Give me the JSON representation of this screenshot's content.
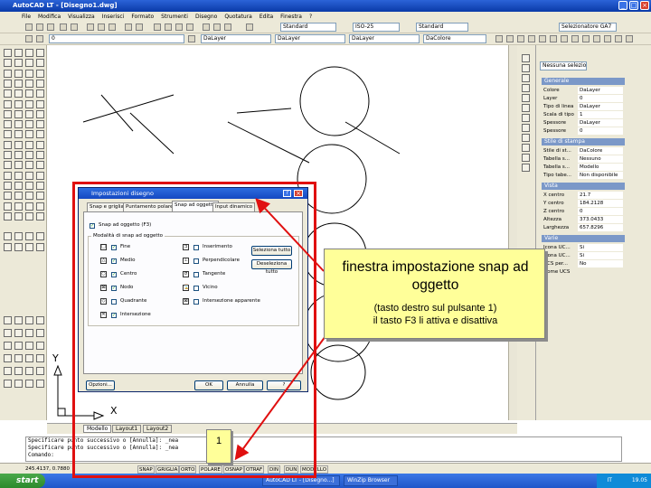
{
  "window": {
    "title": "AutoCAD LT - [Disegno1.dwg]"
  },
  "menu": [
    "File",
    "Modifica",
    "Visualizza",
    "Inserisci",
    "Formato",
    "Strumenti",
    "Disegno",
    "Quotatura",
    "Edita",
    "Finestra",
    "?"
  ],
  "toolbar": {
    "text_style": "Standard",
    "dim_style": "ISO-25",
    "table_style": "Standard",
    "workspace": "Selezionatore GA7",
    "layer": "0",
    "color": "DaLayer",
    "linetype": "DaLayer",
    "lineweight": "DaLayer",
    "plotstyle": "DaColore"
  },
  "properties": {
    "selection": "Nessuna selezione",
    "sections": {
      "general": "Generale",
      "plot": "Stile di stampa",
      "view": "Vista",
      "misc": "Varie"
    },
    "general_rows": [
      {
        "k": "Colore",
        "v": "DaLayer"
      },
      {
        "k": "Layer",
        "v": "0"
      },
      {
        "k": "Tipo di linea",
        "v": "DaLayer"
      },
      {
        "k": "Scala di tipo",
        "v": "1"
      },
      {
        "k": "Spessore",
        "v": "DaLayer"
      },
      {
        "k": "Spessore",
        "v": "0"
      }
    ],
    "plot_rows": [
      {
        "k": "Stile di st...",
        "v": "DaColore"
      },
      {
        "k": "Tabella s...",
        "v": "Nessuno"
      },
      {
        "k": "Tabella s...",
        "v": "Modello"
      },
      {
        "k": "Tipo tabe...",
        "v": "Non disponibile"
      }
    ],
    "view_rows": [
      {
        "k": "X centro",
        "v": "21.7"
      },
      {
        "k": "Y centro",
        "v": "184.2128"
      },
      {
        "k": "Z centro",
        "v": "0"
      },
      {
        "k": "Altezza",
        "v": "373.0433"
      },
      {
        "k": "Larghezza",
        "v": "657.8296"
      }
    ],
    "misc_rows": [
      {
        "k": "Icona UC...",
        "v": "Si"
      },
      {
        "k": "Icona UC...",
        "v": "Si"
      },
      {
        "k": "UCS per...",
        "v": "No"
      },
      {
        "k": "Nome UCS",
        "v": ""
      }
    ]
  },
  "dialog": {
    "title": "Impostazioni disegno",
    "tabs": [
      "Snap e griglia",
      "Puntamento polare",
      "Snap ad oggetto",
      "Input dinamico"
    ],
    "snap_on": "Snap ad oggetto (F3)",
    "modes_title": "Modalità di snap ad oggetto",
    "modes_left": [
      {
        "icon": "□",
        "label": "Fine",
        "checked": true
      },
      {
        "icon": "△",
        "label": "Medio",
        "checked": true
      },
      {
        "icon": "○",
        "label": "Centro",
        "checked": true
      },
      {
        "icon": "⊠",
        "label": "Nodo",
        "checked": true
      },
      {
        "icon": "◇",
        "label": "Quadrante",
        "checked": false
      },
      {
        "icon": "✕",
        "label": "Intersezione",
        "checked": true
      }
    ],
    "modes_right": [
      {
        "icon": "⊐",
        "label": "Inserimento",
        "checked": false
      },
      {
        "icon": "⊥",
        "label": "Perpendicolare",
        "checked": false
      },
      {
        "icon": "σ",
        "label": "Tangente",
        "checked": false
      },
      {
        "icon": "⌛",
        "label": "Vicino",
        "checked": false
      },
      {
        "icon": "⊠",
        "label": "Intersezione apparente",
        "checked": false
      }
    ],
    "select_all": "Seleziona tutto",
    "deselect_all": "Deseleziona tutto",
    "options": "Opzioni...",
    "ok": "OK",
    "cancel": "Annulla",
    "help": "?"
  },
  "layout_tabs": [
    "Modello",
    "Layout1",
    "Layout2"
  ],
  "ucs": {
    "x": "X",
    "y": "Y"
  },
  "command": {
    "line1": "Specificare punto successivo o [Annulla]: _nea",
    "line2": "Specificare punto successivo o [Annulla]: _nea",
    "prompt": "Comando:"
  },
  "status": {
    "coords": "245.4137, 0.7880",
    "buttons": [
      "SNAP",
      "GRIGLIA",
      "ORTO",
      "POLARE",
      "OSNAP",
      "OTRAF",
      "DIN",
      "DUN",
      "MODELLO"
    ]
  },
  "taskbar": {
    "start": "start",
    "tasks": [
      "AutoCAD LT - [Disegno...]",
      "WinZip Browser"
    ],
    "tray_lang": "IT",
    "time": "19.05"
  },
  "callout": {
    "title": "finestra impostazione snap ad oggetto",
    "subtitle_line1": "(tasto destro sul pulsante 1)",
    "subtitle_line2": "il tasto F3 li attiva e disattiva"
  },
  "marker_label": "1",
  "colors": {
    "highlight_red": "#e01010",
    "callout_yellow": "#ffff99",
    "titlebar_blue": "#0a3aa8"
  }
}
